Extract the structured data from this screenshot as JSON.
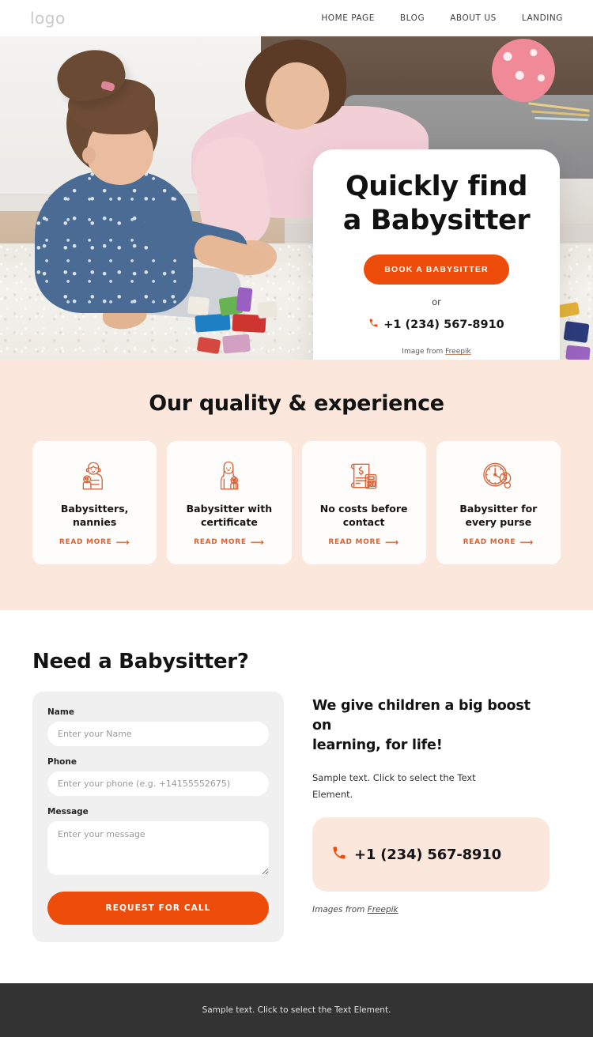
{
  "header": {
    "logo": "logo",
    "nav": [
      {
        "label": "HOME PAGE"
      },
      {
        "label": "BLOG"
      },
      {
        "label": "ABOUT US"
      },
      {
        "label": "LANDING"
      }
    ]
  },
  "hero": {
    "title_line1": "Quickly find",
    "title_line2": "a Babysitter",
    "cta_label": "BOOK A BABYSITTER",
    "or_text": "or",
    "phone": "+1 (234) 567-8910",
    "phone_icon": "phone-icon",
    "credit_prefix": "Image from ",
    "credit_link": "Freepik",
    "image_alt": "mother and toddler playing with blocks on a white rug"
  },
  "features": {
    "title": "Our quality & experience",
    "read_more_label": "READ MORE",
    "arrow_glyph": "⟶",
    "cards": [
      {
        "icon": "babysitter-holding-baby-icon",
        "title_line1": "Babysitters,",
        "title_line2": "nannies"
      },
      {
        "icon": "babysitter-certificate-icon",
        "title_line1": "Babysitter with",
        "title_line2": "certificate"
      },
      {
        "icon": "invoice-calculator-icon",
        "title_line1": "No costs before",
        "title_line2": "contact"
      },
      {
        "icon": "clock-money-icon",
        "title_line1": "Babysitter for",
        "title_line2": "every purse"
      }
    ]
  },
  "contact": {
    "title": "Need a Babysitter?",
    "form": {
      "name_label": "Name",
      "name_placeholder": "Enter your Name",
      "name_value": "",
      "phone_label": "Phone",
      "phone_placeholder": "Enter your phone (e.g. +14155552675)",
      "phone_value": "",
      "message_label": "Message",
      "message_placeholder": "Enter your message",
      "message_value": "",
      "submit_label": "REQUEST FOR CALL"
    },
    "info": {
      "title_line1": "We give children a big boost on",
      "title_line2": "learning, for life!",
      "text_line1": "Sample text. Click to select the Text",
      "text_line2": "Element.",
      "phone": "+1 (234) 567-8910",
      "phone_icon": "phone-icon",
      "credit_prefix": "Images from ",
      "credit_link": "Freepik"
    }
  },
  "footer": {
    "text": "Sample text. Click to select the Text Element."
  },
  "colors": {
    "accent": "#ee4c0a",
    "accent_soft": "#fce7dd",
    "icon_orange": "#d4653a",
    "footer_bg": "#333333",
    "form_bg": "#f0f0f0"
  }
}
